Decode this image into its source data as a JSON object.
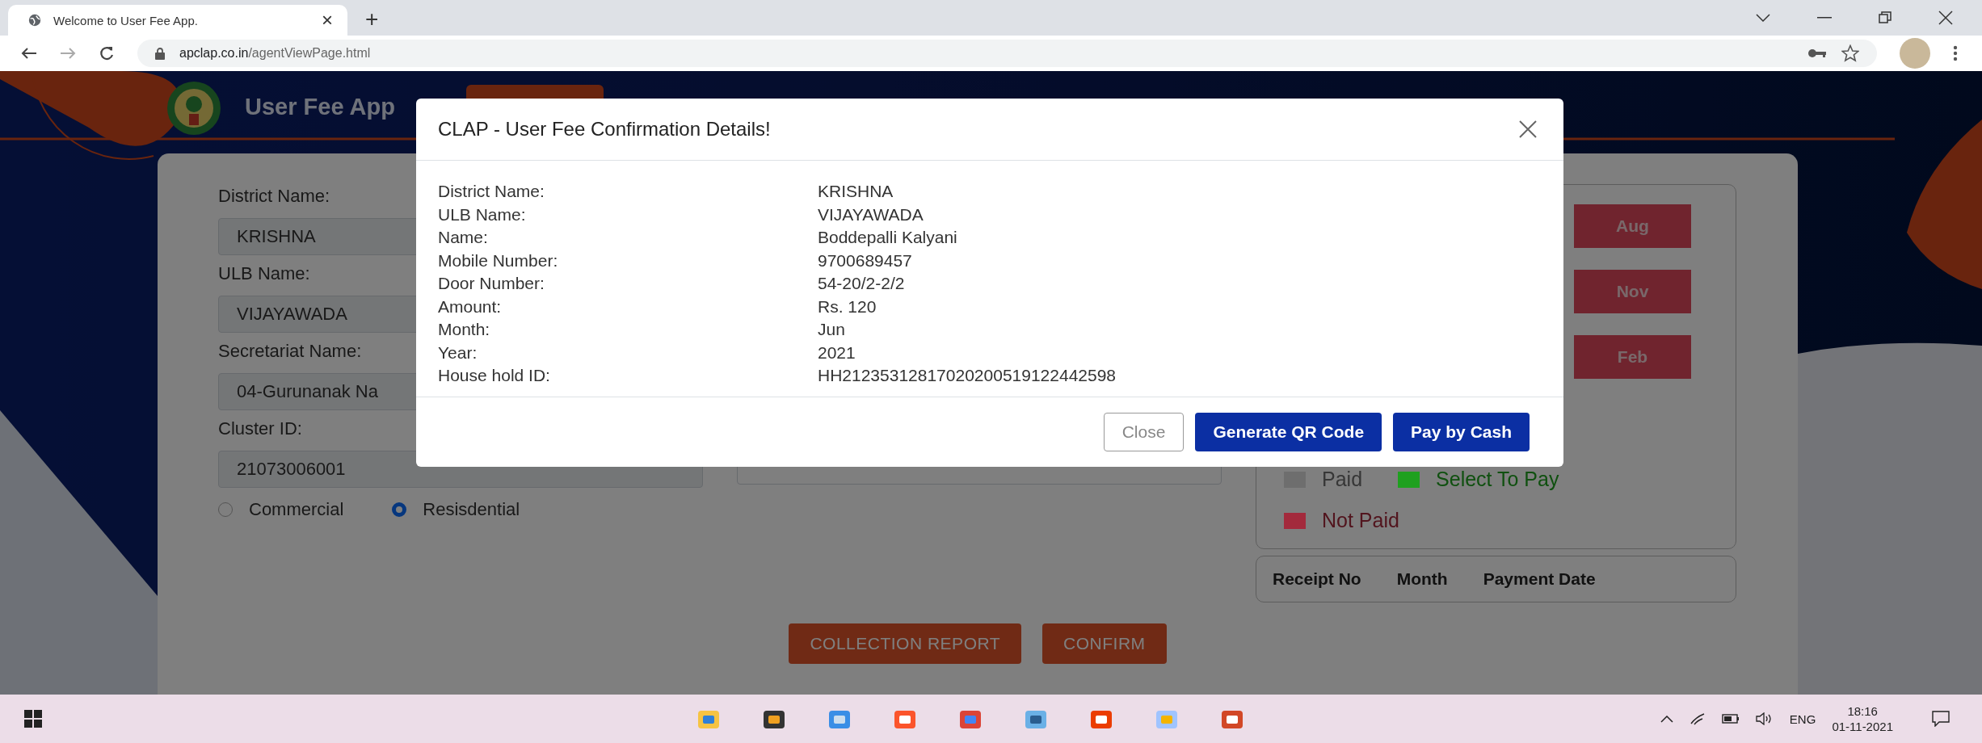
{
  "browser": {
    "tabs": [
      {
        "title": "Welcome to User Fee App.",
        "close": "×",
        "selected": true
      }
    ],
    "new_tab": "+",
    "address": {
      "host": "apclap.co.in",
      "path": "/agentViewPage.html"
    }
  },
  "header": {
    "title": "User Fee App"
  },
  "form": {
    "fields": [
      {
        "label": "District Name:",
        "value": "KRISHNA"
      },
      {
        "label": "ULB Name:",
        "value": "VIJAYAWADA"
      },
      {
        "label": "Secretariat Name:",
        "value": "04-Gurunanak Na"
      },
      {
        "label": "Cluster ID:",
        "value": "21073006001"
      }
    ],
    "radios": [
      {
        "label": "Commercial",
        "selected": false
      },
      {
        "label": "Resisdential",
        "selected": true
      }
    ]
  },
  "months": [
    {
      "label": "Aug"
    },
    {
      "label": "Nov"
    },
    {
      "label": "Feb"
    }
  ],
  "legend": [
    {
      "label": "Paid",
      "color": "#6e6e6e"
    },
    {
      "label": "Select To Pay",
      "color": "#1fa01f"
    },
    {
      "label": "Not Paid",
      "color": "#a32a3c"
    }
  ],
  "receipts": {
    "columns": [
      "Receipt No",
      "Month",
      "Payment Date"
    ]
  },
  "actions": [
    "COLLECTION REPORT",
    "CONFIRM"
  ],
  "modal": {
    "title": "CLAP - User Fee Confirmation Details!",
    "rows": [
      {
        "label": "District Name:",
        "value": "KRISHNA"
      },
      {
        "label": "ULB Name:",
        "value": "VIJAYAWADA"
      },
      {
        "label": "Name:",
        "value": "Boddepalli Kalyani"
      },
      {
        "label": "Mobile Number:",
        "value": "9700689457"
      },
      {
        "label": "Door Number:",
        "value": "54-20/2-2/2"
      },
      {
        "label": "Amount:",
        "value": "Rs. 120"
      },
      {
        "label": "Month:",
        "value": "Jun"
      },
      {
        "label": "Year:",
        "value": "2021"
      },
      {
        "label": "House hold ID:",
        "value": "HH21235312817020200519122442598"
      }
    ],
    "buttons": [
      {
        "label": "Close",
        "kind": "secondary"
      },
      {
        "label": "Generate QR Code",
        "kind": "primary"
      },
      {
        "label": "Pay by Cash",
        "kind": "primary"
      }
    ]
  },
  "taskbar": {
    "language": "ENG",
    "time": "18:16",
    "date": "01-11-2021"
  }
}
